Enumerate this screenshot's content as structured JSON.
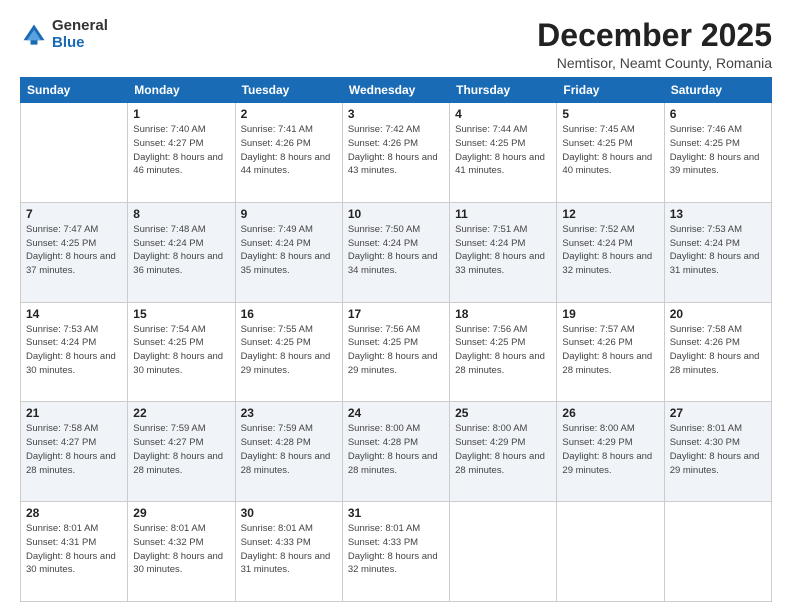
{
  "logo": {
    "general": "General",
    "blue": "Blue"
  },
  "title": "December 2025",
  "subtitle": "Nemtisor, Neamt County, Romania",
  "days_header": [
    "Sunday",
    "Monday",
    "Tuesday",
    "Wednesday",
    "Thursday",
    "Friday",
    "Saturday"
  ],
  "weeks": [
    [
      {
        "day": "",
        "sunrise": "",
        "sunset": "",
        "daylight": ""
      },
      {
        "day": "1",
        "sunrise": "Sunrise: 7:40 AM",
        "sunset": "Sunset: 4:27 PM",
        "daylight": "Daylight: 8 hours and 46 minutes."
      },
      {
        "day": "2",
        "sunrise": "Sunrise: 7:41 AM",
        "sunset": "Sunset: 4:26 PM",
        "daylight": "Daylight: 8 hours and 44 minutes."
      },
      {
        "day": "3",
        "sunrise": "Sunrise: 7:42 AM",
        "sunset": "Sunset: 4:26 PM",
        "daylight": "Daylight: 8 hours and 43 minutes."
      },
      {
        "day": "4",
        "sunrise": "Sunrise: 7:44 AM",
        "sunset": "Sunset: 4:25 PM",
        "daylight": "Daylight: 8 hours and 41 minutes."
      },
      {
        "day": "5",
        "sunrise": "Sunrise: 7:45 AM",
        "sunset": "Sunset: 4:25 PM",
        "daylight": "Daylight: 8 hours and 40 minutes."
      },
      {
        "day": "6",
        "sunrise": "Sunrise: 7:46 AM",
        "sunset": "Sunset: 4:25 PM",
        "daylight": "Daylight: 8 hours and 39 minutes."
      }
    ],
    [
      {
        "day": "7",
        "sunrise": "Sunrise: 7:47 AM",
        "sunset": "Sunset: 4:25 PM",
        "daylight": "Daylight: 8 hours and 37 minutes."
      },
      {
        "day": "8",
        "sunrise": "Sunrise: 7:48 AM",
        "sunset": "Sunset: 4:24 PM",
        "daylight": "Daylight: 8 hours and 36 minutes."
      },
      {
        "day": "9",
        "sunrise": "Sunrise: 7:49 AM",
        "sunset": "Sunset: 4:24 PM",
        "daylight": "Daylight: 8 hours and 35 minutes."
      },
      {
        "day": "10",
        "sunrise": "Sunrise: 7:50 AM",
        "sunset": "Sunset: 4:24 PM",
        "daylight": "Daylight: 8 hours and 34 minutes."
      },
      {
        "day": "11",
        "sunrise": "Sunrise: 7:51 AM",
        "sunset": "Sunset: 4:24 PM",
        "daylight": "Daylight: 8 hours and 33 minutes."
      },
      {
        "day": "12",
        "sunrise": "Sunrise: 7:52 AM",
        "sunset": "Sunset: 4:24 PM",
        "daylight": "Daylight: 8 hours and 32 minutes."
      },
      {
        "day": "13",
        "sunrise": "Sunrise: 7:53 AM",
        "sunset": "Sunset: 4:24 PM",
        "daylight": "Daylight: 8 hours and 31 minutes."
      }
    ],
    [
      {
        "day": "14",
        "sunrise": "Sunrise: 7:53 AM",
        "sunset": "Sunset: 4:24 PM",
        "daylight": "Daylight: 8 hours and 30 minutes."
      },
      {
        "day": "15",
        "sunrise": "Sunrise: 7:54 AM",
        "sunset": "Sunset: 4:25 PM",
        "daylight": "Daylight: 8 hours and 30 minutes."
      },
      {
        "day": "16",
        "sunrise": "Sunrise: 7:55 AM",
        "sunset": "Sunset: 4:25 PM",
        "daylight": "Daylight: 8 hours and 29 minutes."
      },
      {
        "day": "17",
        "sunrise": "Sunrise: 7:56 AM",
        "sunset": "Sunset: 4:25 PM",
        "daylight": "Daylight: 8 hours and 29 minutes."
      },
      {
        "day": "18",
        "sunrise": "Sunrise: 7:56 AM",
        "sunset": "Sunset: 4:25 PM",
        "daylight": "Daylight: 8 hours and 28 minutes."
      },
      {
        "day": "19",
        "sunrise": "Sunrise: 7:57 AM",
        "sunset": "Sunset: 4:26 PM",
        "daylight": "Daylight: 8 hours and 28 minutes."
      },
      {
        "day": "20",
        "sunrise": "Sunrise: 7:58 AM",
        "sunset": "Sunset: 4:26 PM",
        "daylight": "Daylight: 8 hours and 28 minutes."
      }
    ],
    [
      {
        "day": "21",
        "sunrise": "Sunrise: 7:58 AM",
        "sunset": "Sunset: 4:27 PM",
        "daylight": "Daylight: 8 hours and 28 minutes."
      },
      {
        "day": "22",
        "sunrise": "Sunrise: 7:59 AM",
        "sunset": "Sunset: 4:27 PM",
        "daylight": "Daylight: 8 hours and 28 minutes."
      },
      {
        "day": "23",
        "sunrise": "Sunrise: 7:59 AM",
        "sunset": "Sunset: 4:28 PM",
        "daylight": "Daylight: 8 hours and 28 minutes."
      },
      {
        "day": "24",
        "sunrise": "Sunrise: 8:00 AM",
        "sunset": "Sunset: 4:28 PM",
        "daylight": "Daylight: 8 hours and 28 minutes."
      },
      {
        "day": "25",
        "sunrise": "Sunrise: 8:00 AM",
        "sunset": "Sunset: 4:29 PM",
        "daylight": "Daylight: 8 hours and 28 minutes."
      },
      {
        "day": "26",
        "sunrise": "Sunrise: 8:00 AM",
        "sunset": "Sunset: 4:29 PM",
        "daylight": "Daylight: 8 hours and 29 minutes."
      },
      {
        "day": "27",
        "sunrise": "Sunrise: 8:01 AM",
        "sunset": "Sunset: 4:30 PM",
        "daylight": "Daylight: 8 hours and 29 minutes."
      }
    ],
    [
      {
        "day": "28",
        "sunrise": "Sunrise: 8:01 AM",
        "sunset": "Sunset: 4:31 PM",
        "daylight": "Daylight: 8 hours and 30 minutes."
      },
      {
        "day": "29",
        "sunrise": "Sunrise: 8:01 AM",
        "sunset": "Sunset: 4:32 PM",
        "daylight": "Daylight: 8 hours and 30 minutes."
      },
      {
        "day": "30",
        "sunrise": "Sunrise: 8:01 AM",
        "sunset": "Sunset: 4:33 PM",
        "daylight": "Daylight: 8 hours and 31 minutes."
      },
      {
        "day": "31",
        "sunrise": "Sunrise: 8:01 AM",
        "sunset": "Sunset: 4:33 PM",
        "daylight": "Daylight: 8 hours and 32 minutes."
      },
      {
        "day": "",
        "sunrise": "",
        "sunset": "",
        "daylight": ""
      },
      {
        "day": "",
        "sunrise": "",
        "sunset": "",
        "daylight": ""
      },
      {
        "day": "",
        "sunrise": "",
        "sunset": "",
        "daylight": ""
      }
    ]
  ]
}
